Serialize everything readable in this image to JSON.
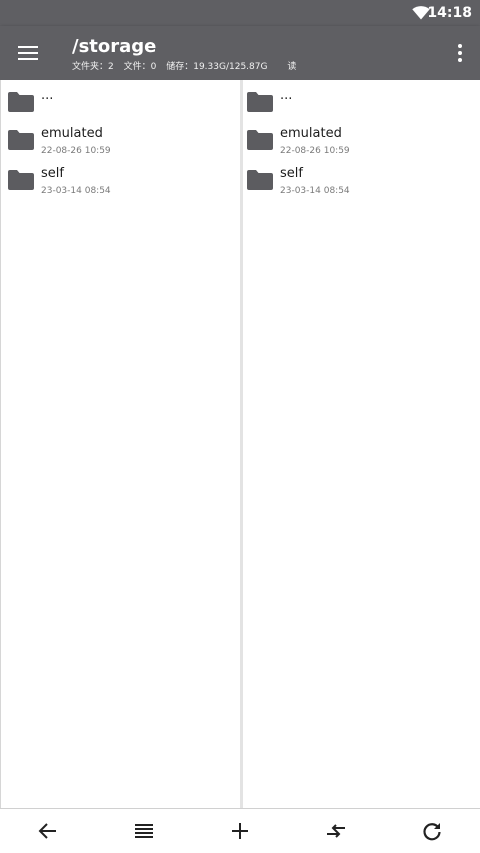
{
  "status_bar": {
    "time": "14:18",
    "icons": [
      "wifi-icon"
    ]
  },
  "app_bar": {
    "title": "/storage",
    "stats": {
      "folders": "文件夹：2",
      "files": "文件：0",
      "storage": "储存：19.33G/125.87G",
      "mode": "读"
    },
    "icons": [
      "menu-icon",
      "more-vert-icon"
    ]
  },
  "left_pane": {
    "items": [
      {
        "name": "...",
        "date": ""
      },
      {
        "name": "emulated",
        "date": "22-08-26 10:59"
      },
      {
        "name": "self",
        "date": "23-03-14 08:54"
      }
    ]
  },
  "right_pane": {
    "items": [
      {
        "name": "...",
        "date": ""
      },
      {
        "name": "emulated",
        "date": "22-08-26 10:59"
      },
      {
        "name": "self",
        "date": "23-03-14 08:54"
      }
    ]
  },
  "bottom_bar": {
    "icons": [
      "back-arrow-icon",
      "list-view-icon",
      "add-icon",
      "swap-panes-icon",
      "refresh-icon"
    ]
  },
  "colors": {
    "app_bar": "#5f5f63",
    "folder_icon": "#5c5c60",
    "divider": "#e3e3e3"
  }
}
